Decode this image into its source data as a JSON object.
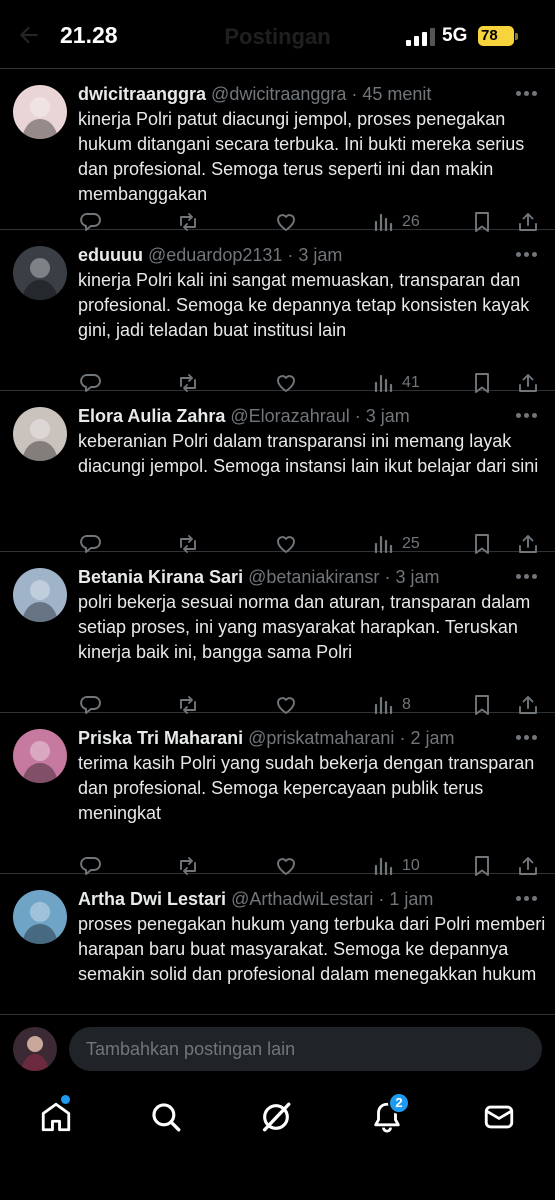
{
  "status": {
    "time": "21.28",
    "network": "5G",
    "battery": "78"
  },
  "header": {
    "title": "Postingan"
  },
  "posts": [
    {
      "name": "dwicitraanggra",
      "handle": "@dwicitraanggra",
      "time": "45 menit",
      "text": "kinerja Polri patut diacungi jempol, proses penegakan hukum ditangani secara terbuka. Ini bukti mereka serius dan profesional. Semoga terus seperti ini dan makin membanggakan",
      "views": "26",
      "avatar_color": "#e9d4d6"
    },
    {
      "name": "eduuuu",
      "handle": "@eduardop2131",
      "time": "3 jam",
      "text": "kinerja Polri kali ini sangat memuaskan, transparan dan profesional. Semoga ke depannya tetap konsisten kayak gini, jadi teladan buat institusi lain",
      "views": "41",
      "avatar_color": "#3a3f45"
    },
    {
      "name": "Elora Aulia Zahra",
      "handle": "@Elorazahraul",
      "time": "3 jam",
      "text": "keberanian Polri dalam transparansi ini memang layak diacungi jempol. Semoga instansi lain ikut belajar dari sini",
      "views": "25",
      "avatar_color": "#c9c2bd"
    },
    {
      "name": "Betania Kirana Sari",
      "handle": "@betaniakiransr",
      "time": "3 jam",
      "text": "polri bekerja sesuai norma dan aturan, transparan dalam setiap proses, ini yang masyarakat harapkan. Teruskan kinerja baik ini, bangga sama Polri",
      "views": "8",
      "avatar_color": "#9fb3c9"
    },
    {
      "name": "Priska Tri Maharani",
      "handle": "@priskatmaharani",
      "time": "2 jam",
      "text": "terima kasih Polri yang sudah bekerja dengan transparan dan profesional. Semoga kepercayaan publik terus meningkat",
      "views": "10",
      "avatar_color": "#c77aa0"
    },
    {
      "name": "Artha Dwi Lestari",
      "handle": "@ArthadwiLestari",
      "time": "1 jam",
      "text": "proses penegakan hukum yang terbuka dari Polri memberi harapan baru buat masyarakat. Semoga ke depannya semakin solid dan profesional dalam menegakkan hukum",
      "views": "",
      "avatar_color": "#6fa4c7"
    }
  ],
  "reply": {
    "placeholder": "Tambahkan postingan lain"
  },
  "nav": {
    "notifications_badge": "2"
  },
  "colors": {
    "background": "#000000",
    "text": "#e7e9ea",
    "muted": "#71767b",
    "accent": "#1d9bf0",
    "divider": "#2f3336"
  }
}
